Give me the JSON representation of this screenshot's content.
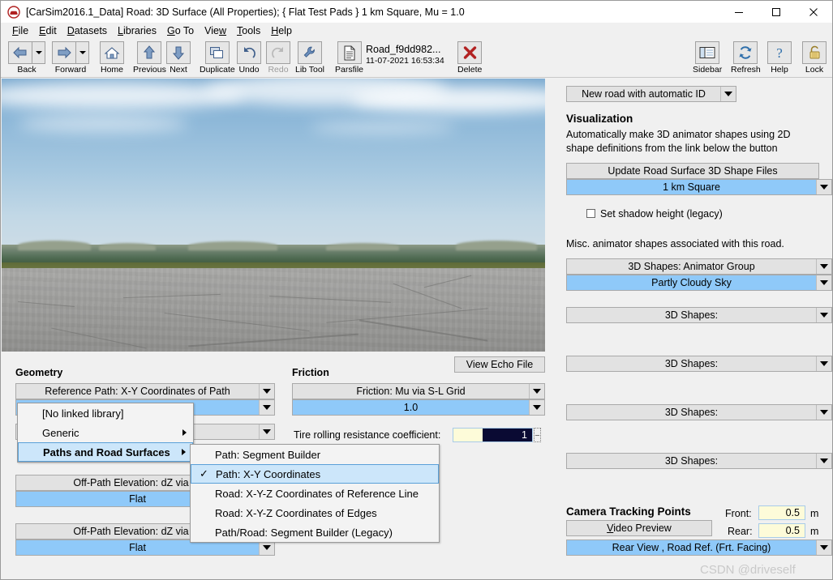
{
  "window": {
    "title": "[CarSim2016.1_Data] Road: 3D Surface (All Properties); { Flat Test Pads } 1 km Square, Mu = 1.0",
    "app_icon": "carsim-icon",
    "minimize": "minimize-icon",
    "maximize": "maximize-icon",
    "close": "close-icon"
  },
  "menubar": [
    {
      "label": "File",
      "accel": "F"
    },
    {
      "label": "Edit",
      "accel": "E"
    },
    {
      "label": "Datasets",
      "accel": "D"
    },
    {
      "label": "Libraries",
      "accel": "L"
    },
    {
      "label": "Go To",
      "accel": "G"
    },
    {
      "label": "View",
      "accel": "w"
    },
    {
      "label": "Tools",
      "accel": "T"
    },
    {
      "label": "Help",
      "accel": "H"
    }
  ],
  "toolbar": {
    "left": [
      {
        "label": "Back",
        "icon": "arrow-left-icon",
        "split": true,
        "disabled": false
      },
      {
        "label": "Forward",
        "icon": "arrow-right-icon",
        "split": true,
        "disabled": false
      },
      {
        "label": "Home",
        "icon": "home-icon",
        "split": false,
        "disabled": false
      },
      {
        "label": "Previous",
        "icon": "arrow-up-icon",
        "split": false,
        "disabled": false
      },
      {
        "label": "Next",
        "icon": "arrow-down-icon",
        "split": false,
        "disabled": false
      },
      {
        "label": "Duplicate",
        "icon": "duplicate-icon",
        "split": false,
        "disabled": false
      },
      {
        "label": "Undo",
        "icon": "undo-icon",
        "split": false,
        "disabled": false
      },
      {
        "label": "Redo",
        "icon": "redo-icon",
        "split": false,
        "disabled": true
      },
      {
        "label": "Lib Tool",
        "icon": "wrench-icon",
        "split": false,
        "disabled": false
      },
      {
        "label": "Parsfile",
        "icon": "document-icon",
        "split": false,
        "disabled": false
      },
      {
        "label": "Delete",
        "icon": "red-x-icon",
        "split": false,
        "disabled": false
      }
    ],
    "parsfile": {
      "name": "Road_f9dd982...",
      "date": "11-07-2021 16:53:34"
    },
    "right": [
      {
        "label": "Sidebar",
        "icon": "sidebar-icon"
      },
      {
        "label": "Refresh",
        "icon": "refresh-icon"
      },
      {
        "label": "Help",
        "icon": "question-mark-icon"
      },
      {
        "label": "Lock",
        "icon": "padlock-icon"
      }
    ]
  },
  "viewport": {
    "name": "3d-road-preview"
  },
  "geometry": {
    "heading": "Geometry",
    "reference_path_combo": "Reference Path: X-Y Coordinates of Path",
    "reference_path_value": "",
    "hidden_combo_label": "",
    "offpath1_label": "Off-Path Elevation: dZ via S-",
    "offpath1_value": "Flat",
    "offpath2_label": "Off-Path Elevation: dZ via S-",
    "offpath2_value": "Flat"
  },
  "friction": {
    "heading": "Friction",
    "view_echo_file": "View Echo File",
    "combo_label": "Friction: Mu via S-L Grid",
    "combo_value": "1.0",
    "rolling_label": "Tire rolling resistance coefficient:",
    "rolling_value": "1"
  },
  "library_menu": {
    "items": [
      {
        "label": "[No linked library]",
        "submenu": false,
        "selected": false,
        "bold": false
      },
      {
        "label": "Generic",
        "submenu": true,
        "selected": false,
        "bold": false
      },
      {
        "label": "Paths and Road Surfaces",
        "submenu": true,
        "selected": true,
        "bold": true
      }
    ]
  },
  "library_submenu": {
    "items": [
      {
        "label": "Path: Segment Builder",
        "checked": false
      },
      {
        "label": "Path: X-Y Coordinates",
        "checked": true
      },
      {
        "label": "Road: X-Y-Z Coordinates of Reference Line",
        "checked": false
      },
      {
        "label": "Road: X-Y-Z Coordinates of Edges",
        "checked": false
      },
      {
        "label": "Path/Road: Segment Builder (Legacy)",
        "checked": false
      }
    ]
  },
  "sidebar": {
    "dataset_combo": "New road with automatic ID",
    "visualization_heading": "Visualization",
    "visualization_text_line1": "Automatically make 3D animator shapes using 2D",
    "visualization_text_line2": "shape definitions from the link below the button",
    "update_button": "Update Road Surface 3D Shape Files",
    "shape_file_value": "1 km Square",
    "shadow_checkbox_label": "Set shadow height (legacy)",
    "shadow_checkbox_checked": false,
    "misc_text": "Misc. animator shapes associated with this road.",
    "animator_group_label": "3D Shapes: Animator Group",
    "animator_group_value": "Partly Cloudy Sky",
    "shape_slots": [
      "3D Shapes:",
      "3D Shapes:",
      "3D Shapes:",
      "3D Shapes:"
    ],
    "camera": {
      "heading": "Camera Tracking Points",
      "video_preview": "Video Preview",
      "front_label": "Front:",
      "front_value": "0.5",
      "front_unit": "m",
      "rear_label": "Rear:",
      "rear_value": "0.5",
      "rear_unit": "m",
      "view_combo": "Rear View , Road Ref. (Frt. Facing)"
    }
  },
  "watermark": "CSDN @driveself"
}
